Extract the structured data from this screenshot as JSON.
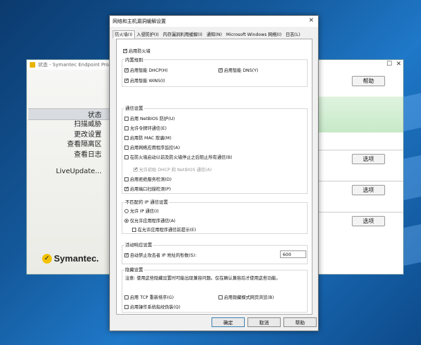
{
  "background_window": {
    "title": "状态 - Symantec Endpoint Protecti",
    "nav_items": [
      "状态",
      "扫描威胁",
      "更改设置",
      "查看隔离区",
      "查看日志",
      "LiveUpdate..."
    ],
    "help_button": "帮助",
    "options_buttons": [
      "选项",
      "选项",
      "选项"
    ],
    "logo_text": "Symantec."
  },
  "dialog": {
    "title": "网络和主机漏洞缓解设置",
    "close": "✕",
    "tabs": [
      "防火墙(I)",
      "入侵防护(I)",
      "内存漏洞利用缓解(I)",
      "通知(N)",
      "Microsoft Windows 网络(I)",
      "日志(L)"
    ],
    "enable_firewall": "启用防火墙",
    "builtin_rules": {
      "title": "内置规则",
      "smart_dhcp": "启用智能 DHCP(H)",
      "smart_dns": "启用智能 DNS(Y)",
      "smart_wins": "启用智能 WINS(I)"
    },
    "comm_settings": {
      "title": "通信设置",
      "items": [
        "启用 NetBIOS 防护(U)",
        "允许令牌环通信(E)",
        "启用防 MAC 欺骗(M)",
        "启用网络应用程序监控(A)",
        "在防火墙启动以前及防火墙停止之后阻止所有通信(B)",
        "允许初始 DHCP 和 NetBIOS 通信(A)",
        "启用拒绝服务检测(D)",
        "启用端口扫描检测(P)"
      ]
    },
    "unmatched_ip": {
      "title": "不匹配的 IP 通信设置",
      "allow_ip": "允许 IP 通信(I)",
      "allow_app_only": "仅允许应用程序通信(A)",
      "prompt": "在允许应用程序通信前提示(E)"
    },
    "active_response": {
      "title": "活动响应设置",
      "auto_block": "自动禁止攻击者 IP 地址的秒数(S):",
      "seconds": "600"
    },
    "stealth": {
      "title": "隐藏设置",
      "note": "注意: 使用这些隐藏设置时可能出现兼容问题。仅在确认兼容后才使用这些功能。",
      "tcp_resequencing": "启用 TCP 重新排序(G)",
      "stealth_web": "启用隐藏模式网页浏览(B)",
      "os_fingerprint": "启用操作系统指纹伪装(Q)"
    },
    "buttons": {
      "ok": "确定",
      "cancel": "取消",
      "help": "帮助"
    }
  }
}
